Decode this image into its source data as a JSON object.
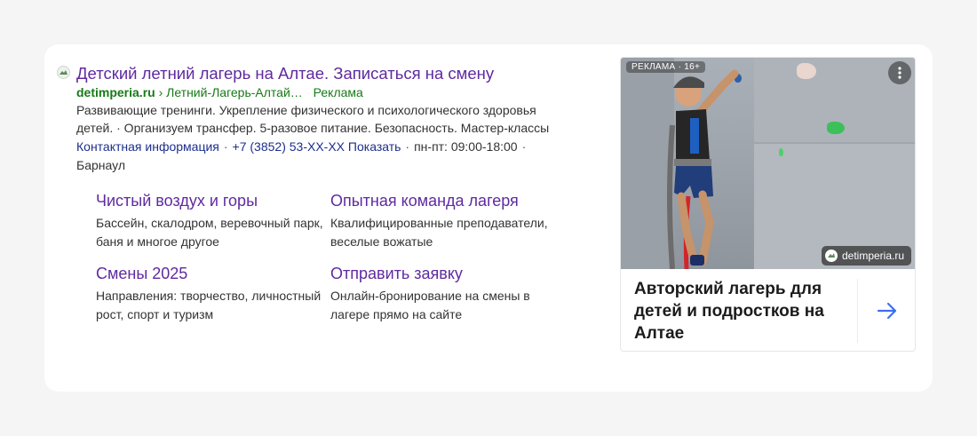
{
  "ad": {
    "title": "Детский летний лагерь на Алтае. Записаться на смену",
    "domain": "detimperia.ru",
    "separator": "›",
    "path": "Летний-Лагерь-Алтай…",
    "ad_label": "Реклама",
    "description": "Развивающие тренинги. Укрепление физического и психологического здоровья детей. · Организуем трансфер. 5-разовое питание. Безопасность. Мастер-классы",
    "contacts": {
      "info_label": "Контактная информация",
      "phone": "+7 (3852) 53-XX-XX",
      "show_label": "Показать",
      "hours": "пн-пт: 09:00-18:00",
      "city": "Барнаул"
    },
    "sitelinks": [
      {
        "title": "Чистый воздух и горы",
        "desc": "Бассейн, скалодром, веревочный парк, баня и многое другое"
      },
      {
        "title": "Опытная команда лагеря",
        "desc": "Квалифицированные преподаватели, веселые вожатые"
      },
      {
        "title": "Смены 2025",
        "desc": "Направления: творчество, личностный рост, спорт и туризм"
      },
      {
        "title": "Отправить заявку",
        "desc": "Онлайн-бронирование на смены в лагере прямо на сайте"
      }
    ]
  },
  "image_card": {
    "badge": "РЕКЛАМА · 16+",
    "more_icon": "more-vertical-icon",
    "site_label": "detimperia.ru",
    "caption": "Авторский лагерь для детей и подростков на Алтае",
    "arrow_icon": "arrow-right-icon"
  },
  "colors": {
    "link_purple": "#5f2aa0",
    "url_green": "#177a17",
    "contact_blue": "#1c2f8c",
    "arrow_blue": "#3c6ff0"
  }
}
